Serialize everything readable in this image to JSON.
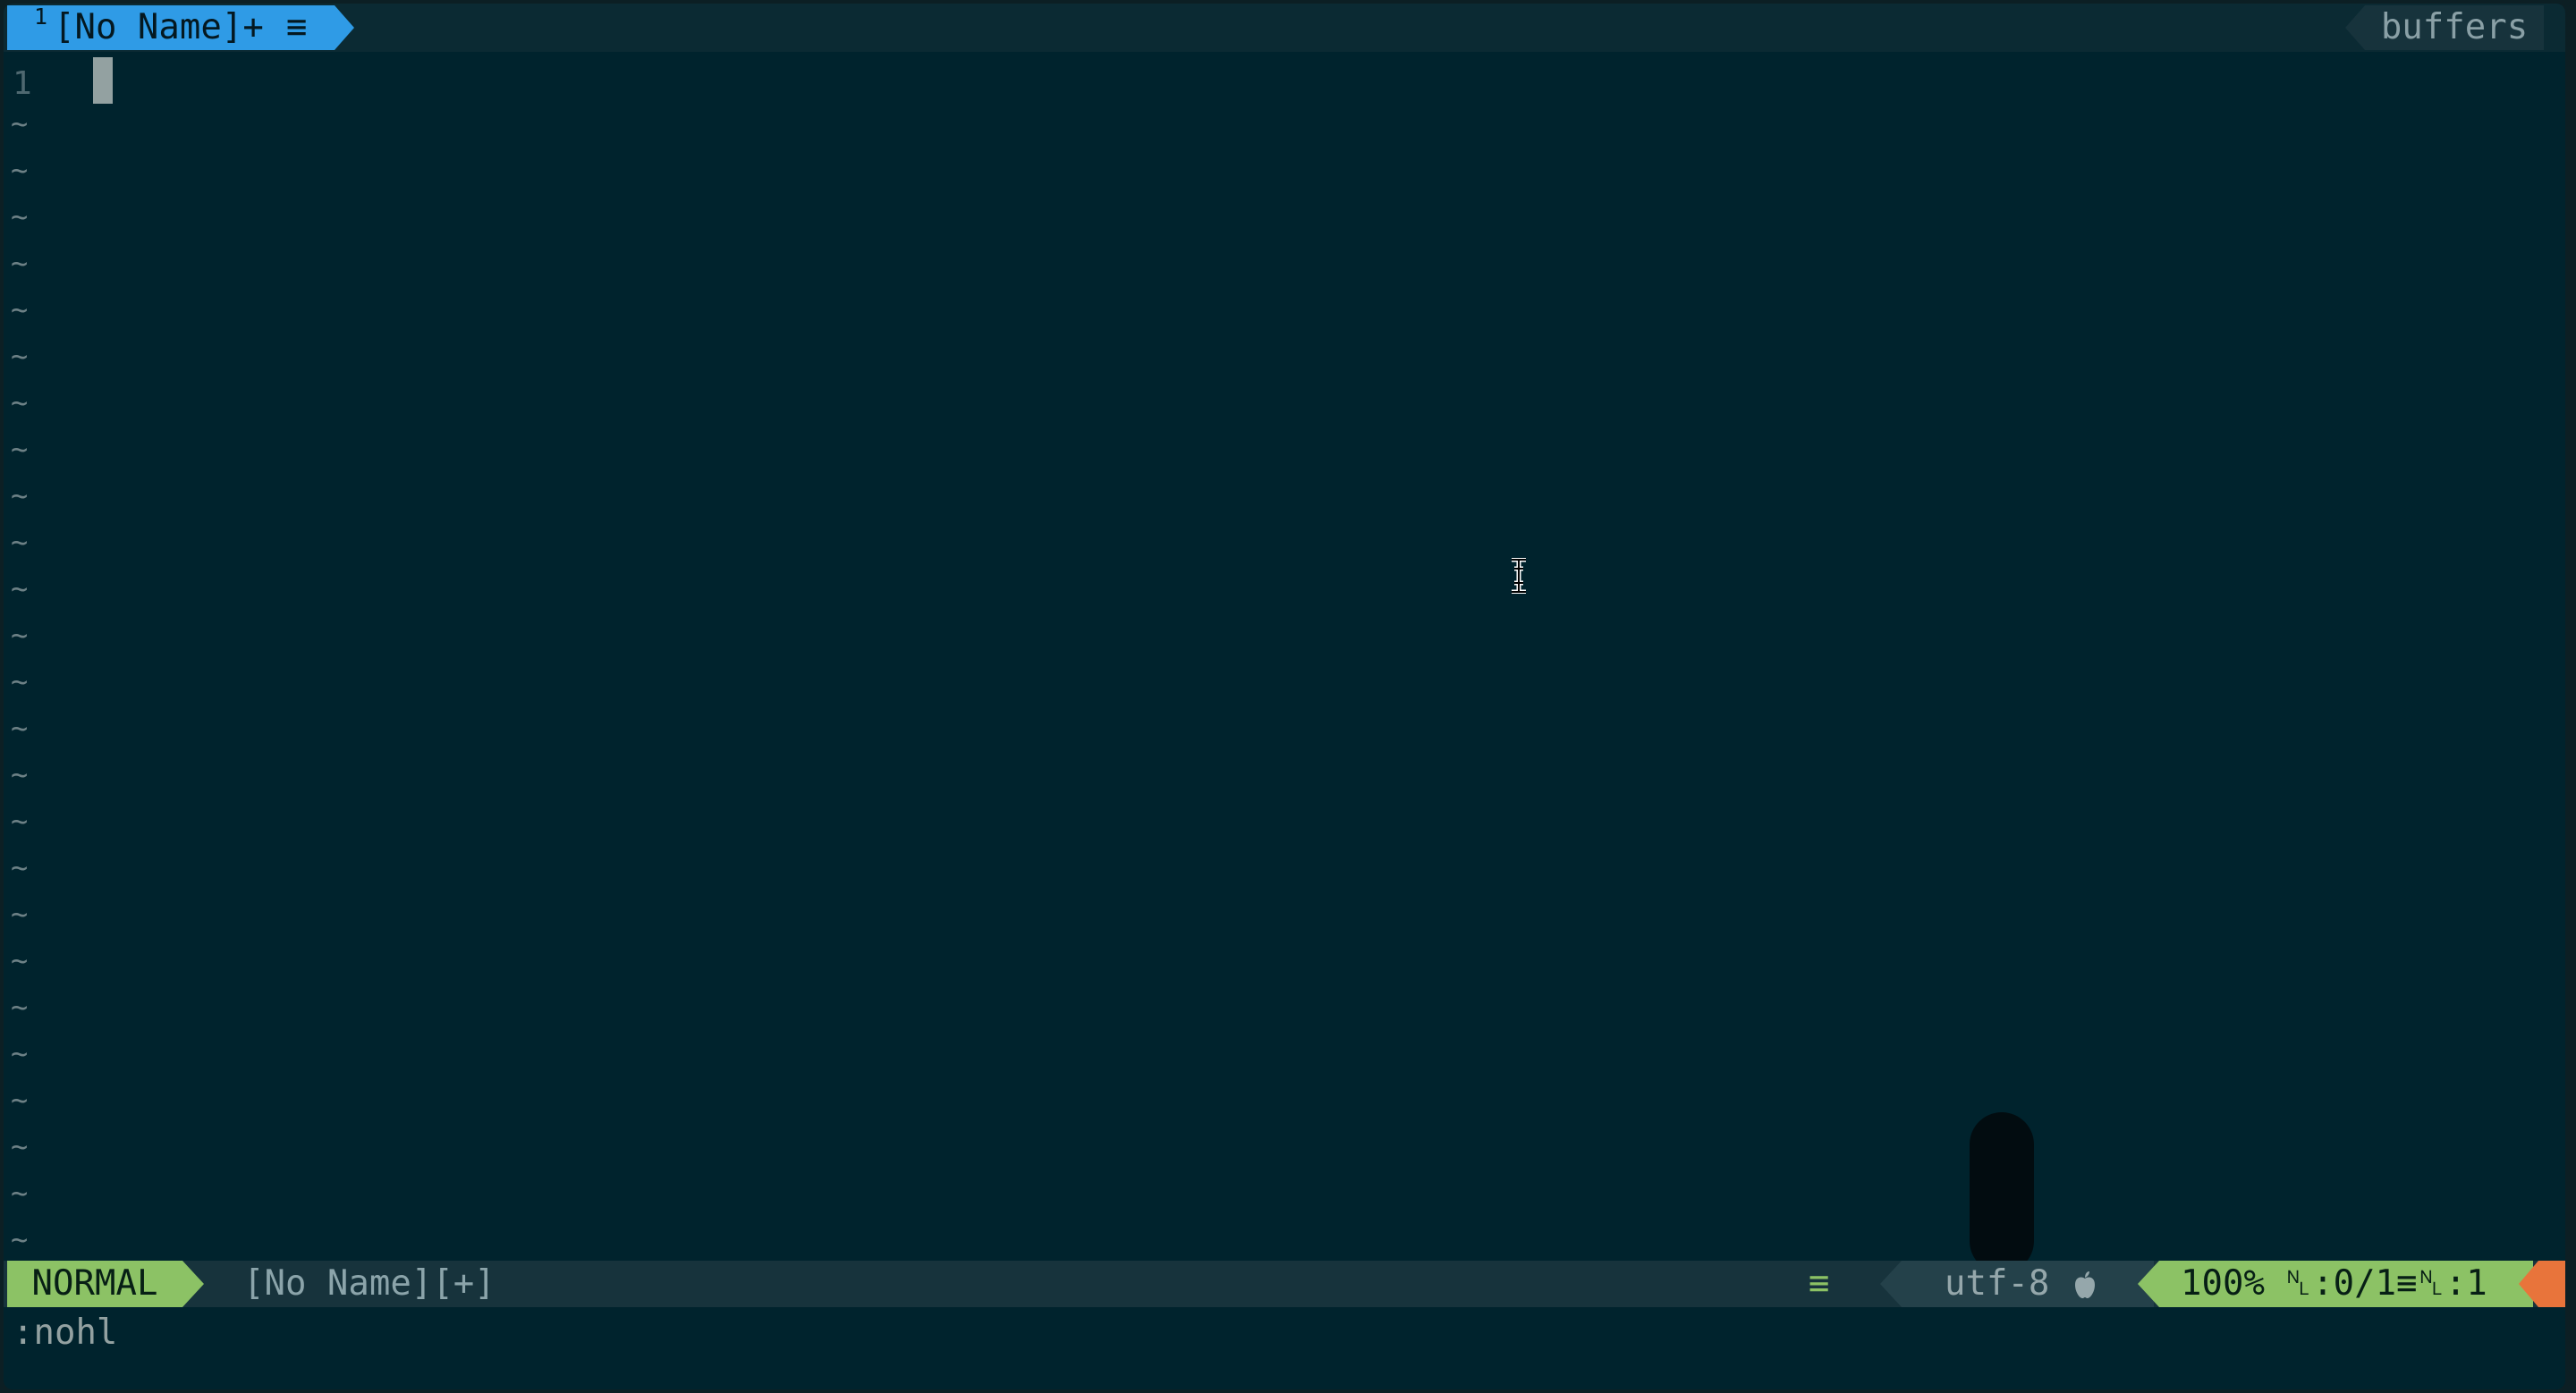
{
  "tabline": {
    "active_tab": {
      "number": "1",
      "label": "[No Name]+",
      "icon": "≡"
    },
    "right_label": "buffers"
  },
  "editor": {
    "line_number": "1",
    "empty_line_marker": "~",
    "empty_line_count": 25
  },
  "statusline": {
    "mode": "NORMAL",
    "filename": "[No Name][+]",
    "fileformat_icon": "≡",
    "encoding": "utf-8",
    "os_icon": "apple-icon",
    "percent": "100%",
    "position": "␤:0/1≡␤:1"
  },
  "cmdline": {
    "text": ":nohl"
  },
  "colors": {
    "background": "#00232d",
    "tab_active": "#2f9be6",
    "mode_green": "#8cc265",
    "warning_orange": "#e8743b",
    "statusline_bg": "#17333c"
  }
}
